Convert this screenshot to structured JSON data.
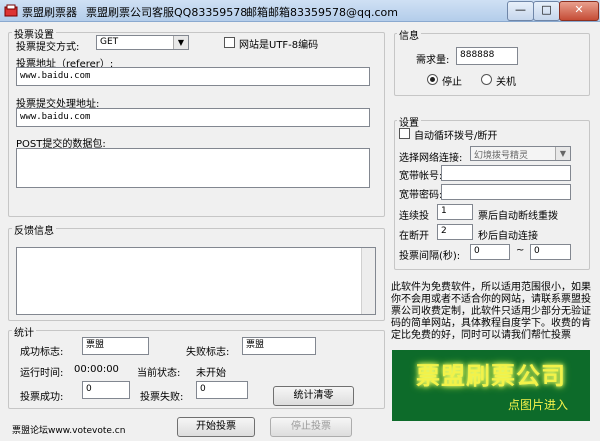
{
  "titlebar": {
    "app_title": "票盟刷票器",
    "service_qq": "票盟刷票公司客服QQ83359578",
    "email": "邮箱邮箱83359578@qq.com",
    "min": "—",
    "max": "□",
    "close": "✕"
  },
  "vote_settings": {
    "legend": "投票设置",
    "method_label": "投票提交方式:",
    "method_value": "GET",
    "utf8_label": "网站是UTF-8编码",
    "referer_label": "投票地址（referer）:",
    "referer_value": "www.baidu.com",
    "handler_label": "投票提交处理地址:",
    "handler_value": "www.baidu.com",
    "post_label": "POST提交的数据包:",
    "post_value": ""
  },
  "feedback": {
    "legend": "反馈信息"
  },
  "info": {
    "legend": "信息",
    "demand_label": "需求量:",
    "demand_value": "888888",
    "stop_label": "停止",
    "shutdown_label": "关机"
  },
  "settings": {
    "legend": "设置",
    "auto_redial_label": "自动循环拨号/断开",
    "network_label": "选择网络连接:",
    "network_value": "幻境拨号精灵",
    "account_label": "宽带帐号:",
    "password_label": "宽带密码:",
    "votes_label": "连续投",
    "votes_value": "1",
    "votes_suffix": "票后自动断线重拨",
    "disconnect_label": "在断开",
    "disconnect_value": "2",
    "disconnect_suffix": "秒后自动连接",
    "interval_label": "投票间隔(秒):",
    "interval_from": "0",
    "interval_sep": "~",
    "interval_to": "0"
  },
  "notice": "此软件为免费软件，所以适用范围很小，如果你不会用或者不适合你的网站，请联系票盟投票公司收费定制，此软件只适用少部分无验证码的简单网站，具体教程自度学下。收费的肯定比免费的好，同时可以请我们帮忙投票",
  "banner": {
    "title": "票盟刷票公司",
    "subtitle": "点图片进入"
  },
  "stats": {
    "legend": "统计",
    "success_flag_label": "成功标志:",
    "success_flag_value": "票盟",
    "fail_flag_label": "失败标志:",
    "fail_flag_value": "票盟",
    "run_time_label": "运行时间:",
    "run_time_value": "00:00:00",
    "status_label": "当前状态:",
    "status_value": "未开始",
    "vote_success_label": "投票成功:",
    "vote_success_value": "0",
    "vote_fail_label": "投票失败:",
    "vote_fail_value": "0",
    "clear_button": "统计清零"
  },
  "footer": {
    "forum_link": "票盟论坛www.votevote.cn",
    "start_button": "开始投票",
    "stop_button": "停止投票"
  }
}
